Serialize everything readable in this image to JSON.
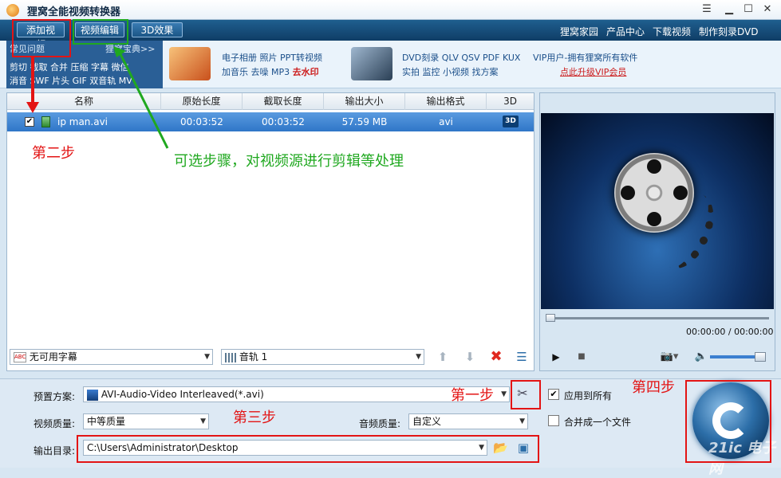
{
  "window": {
    "title": "狸窝全能视频转换器"
  },
  "toolbar": {
    "add_video": "添加视频",
    "edit_video": "视频编辑",
    "effect_3d": "3D效果",
    "links": [
      "狸窝家园",
      "产品中心",
      "下载视频",
      "制作刻录DVD"
    ]
  },
  "faq": {
    "title": "常见问题",
    "more": "狸窝宝典>>",
    "line1": "剪切 截取 合并 压缩 字幕 微信",
    "line2": "消音 SWF 片头 GIF 双音轨 MV"
  },
  "ads": {
    "ad1_line1": "电子相册 照片 PPT转视频",
    "ad1_line2": "加音乐 去噪 MP3",
    "ad1_bold": "去水印",
    "ad2_line1": "DVD刻录 QLV QSV PDF KUX",
    "ad2_line2": "实拍 监控 小视频 找方案",
    "vip_line": "VIP用户-拥有狸窝所有软件",
    "vip_link": "点此升级VIP会员"
  },
  "file_list": {
    "columns": [
      "名称",
      "原始长度",
      "截取长度",
      "输出大小",
      "输出格式",
      "3D"
    ],
    "rows": [
      {
        "name": "ip man.avi",
        "original": "00:03:52",
        "clip": "00:03:52",
        "size": "57.59 MB",
        "format": "avi",
        "three_d": "3D"
      }
    ],
    "subtitle_select": "无可用字幕",
    "audio_select": "音轨 1"
  },
  "player": {
    "timecode": "00:00:00 / 00:00:00"
  },
  "settings": {
    "preset_label": "预置方案:",
    "preset_value": "AVI-Audio-Video Interleaved(*.avi)",
    "video_quality_label": "视频质量:",
    "video_quality_value": "中等质量",
    "audio_quality_label": "音频质量:",
    "audio_quality_value": "自定义",
    "output_label": "输出目录:",
    "output_value": "C:\\Users\\Administrator\\Desktop",
    "apply_all": "应用到所有",
    "merge_one": "合并成一个文件"
  },
  "annotations": {
    "step1": "第一步",
    "step2": "第二步",
    "step3": "第三步",
    "step4": "第四步",
    "optional": "可选步骤，对视频源进行剪辑等处理"
  },
  "watermark": "21ic 电子网",
  "colors": {
    "accent": "#1f5f8f",
    "annotation_red": "#e31414",
    "annotation_green": "#1fa81f",
    "selection": "#2f76c8"
  }
}
